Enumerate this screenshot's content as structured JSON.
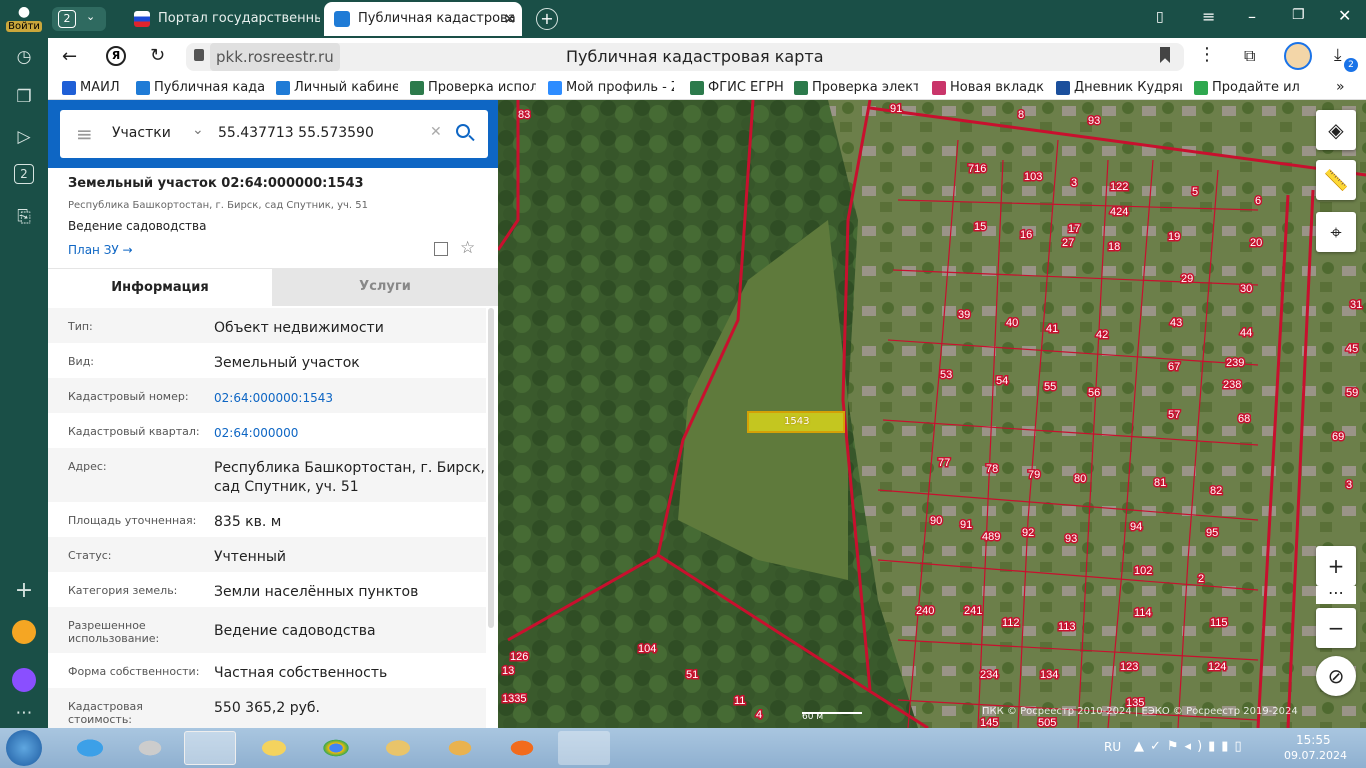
{
  "browser": {
    "login_label": "Войти",
    "tab_count": "2",
    "tabs": [
      {
        "title": "Портал государственных"
      },
      {
        "title": "Публичная кадастрова"
      }
    ],
    "url": "pkk.rosreestr.ru",
    "page_title": "Публичная кадастровая карта",
    "downloads_badge": "2",
    "rail_badge": "2"
  },
  "bookmarks": [
    "МАЙЛ",
    "Публичная кадаст",
    "Личный кабинет",
    "Проверка исполн",
    "Мой профиль - Zo",
    "ФГИС ЕГРН",
    "Проверка электр",
    "Новая вкладка",
    "Дневник Кудряш",
    "Продайте ил"
  ],
  "search": {
    "type_label": "Участки",
    "query": "55.437713 55.573590"
  },
  "parcel": {
    "title": "Земельный участок 02:64:000000:1543",
    "address_short": "Республика Башкортостан, г. Бирск, сад Спутник, уч. 51",
    "use": "Ведение садоводства",
    "plan_link": "План ЗУ →"
  },
  "tabs": {
    "info": "Информация",
    "services": "Услуги"
  },
  "rows": [
    {
      "label": "Тип:",
      "value": "Объект недвижимости"
    },
    {
      "label": "Вид:",
      "value": "Земельный участок"
    },
    {
      "label": "Кадастровый номер:",
      "value": "02:64:000000:1543"
    },
    {
      "label": "Кадастровый квартал:",
      "value": "02:64:000000"
    },
    {
      "label": "Адрес:",
      "value": "Республика Башкортостан, г. Бирск, сад Спутник, уч. 51"
    },
    {
      "label": "Площадь уточненная:",
      "value": "835 кв. м"
    },
    {
      "label": "Статус:",
      "value": "Учтенный"
    },
    {
      "label": "Категория земель:",
      "value": "Земли населённых пунктов"
    },
    {
      "label": "Разрешенное использование:",
      "value": "Ведение садоводства"
    },
    {
      "label": "Форма собственности:",
      "value": "Частная собственность"
    },
    {
      "label": "Кадастровая стоимость:",
      "value": "550 365,2 руб."
    }
  ],
  "map": {
    "parcel_label": "1543",
    "scale": "60 м",
    "copyright": "ПКК © Росреестр 2010-2024 | ЕЭКО © Росреестр 2019-2024",
    "plots": [
      "83",
      "91",
      "8",
      "93",
      "716",
      "103",
      "3",
      "122",
      "5",
      "6",
      "424",
      "15",
      "16",
      "27",
      "17",
      "18",
      "19",
      "20",
      "29",
      "30",
      "39",
      "40",
      "41",
      "42",
      "43",
      "44",
      "239",
      "53",
      "54",
      "55",
      "56",
      "67",
      "238",
      "57",
      "68",
      "77",
      "78",
      "79",
      "80",
      "81",
      "82",
      "90",
      "91",
      "489",
      "92",
      "93",
      "94",
      "95",
      "102",
      "2",
      "240",
      "241",
      "112",
      "113",
      "114",
      "115",
      "104",
      "51",
      "11",
      "4",
      "126",
      "13",
      "1335",
      "234",
      "134",
      "123",
      "124",
      "135",
      "145",
      "505",
      "31",
      "45",
      "59",
      "69",
      "3"
    ]
  },
  "taskbar": {
    "lang": "RU",
    "time": "15:55",
    "date": "09.07.2024"
  }
}
